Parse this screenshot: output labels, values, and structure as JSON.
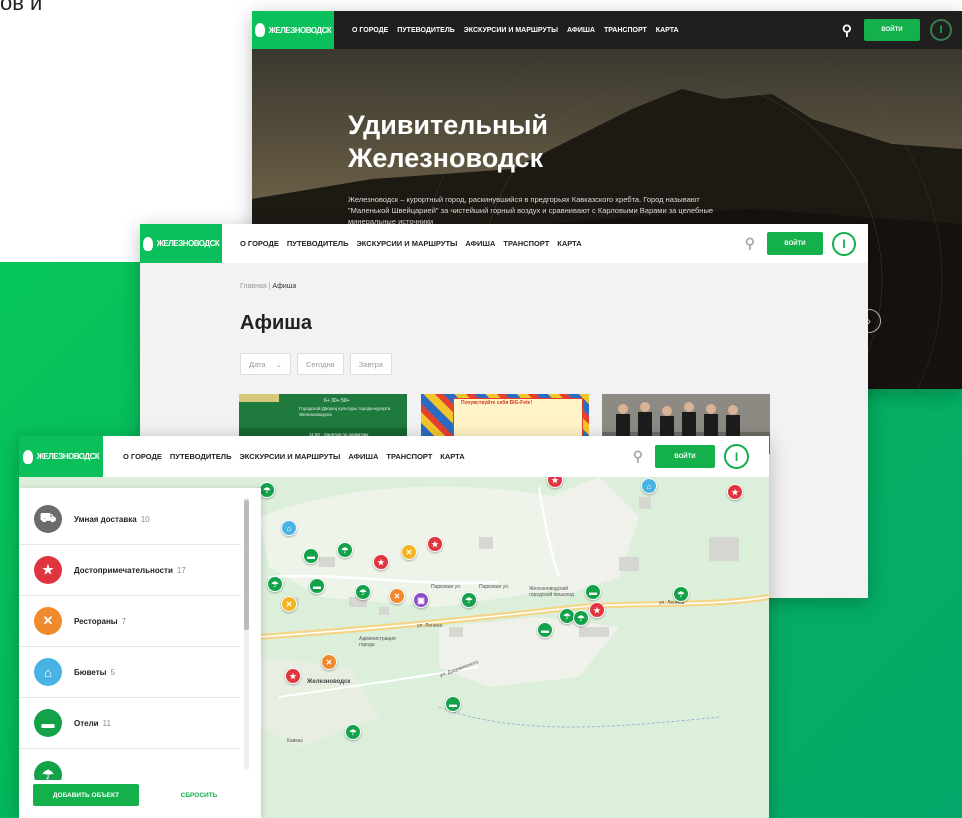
{
  "corner_text": "ов и",
  "logo_text": "ЖЕЛЕЗНОВОДСК",
  "nav_items": [
    "О ГОРОДЕ",
    "ПУТЕВОДИТЕЛЬ",
    "ЭКСКУРСИИ И МАРШРУТЫ",
    "АФИША",
    "ТРАНСПОРТ",
    "КАРТА"
  ],
  "login_label": "ВОЙТИ",
  "info_icon_glyph": "i",
  "search_icon_glyph": "⚲",
  "hero": {
    "title_line1": "Удивительный",
    "title_line2": "Железноводск",
    "text": "Железноводск – курортный город, раскинувшийся в предгорьях Кавказского хребта. Город называют \"Маленькой Швейцарией\" за чистейший горный воздух и сравнивают с Карловыми Варами за целебные минеральные источники",
    "next_arrow": "›"
  },
  "afisha": {
    "breadcrumb_home": "Главная",
    "breadcrumb_current": "Афиша",
    "title": "Афиша",
    "filters": [
      "Дата",
      "Сегодня",
      "Завтра"
    ],
    "date_chevron": "⌄",
    "card1_text": "Городской Дворец культуры города-курорта Железноводска",
    "card1_time": "11:00 - Занятия по развитию",
    "card1_age": "6+ 30+ 50+",
    "card2_text": "Почувствуйте себя BIG-Fete!"
  },
  "map": {
    "categories": [
      {
        "label": "Умная доставка",
        "count": "10",
        "color": "#6b6b6b",
        "icon": "truck-icon",
        "glyph": "⛟"
      },
      {
        "label": "Достопримечательности",
        "count": "17",
        "color": "#e0343f",
        "icon": "star-icon",
        "glyph": "★"
      },
      {
        "label": "Рестораны",
        "count": "7",
        "color": "#f08a2c",
        "icon": "fork-knife-icon",
        "glyph": "✕"
      },
      {
        "label": "Бюветы",
        "count": "5",
        "color": "#4ab3e6",
        "icon": "water-icon",
        "glyph": "⌂"
      },
      {
        "label": "Отели",
        "count": "11",
        "color": "#13a24a",
        "icon": "bed-icon",
        "glyph": "▬"
      },
      {
        "label": "",
        "count": "",
        "color": "#13a24a",
        "icon": "umbrella-icon",
        "glyph": "☂"
      }
    ],
    "add_button": "ДОБАВИТЬ ОБЪЕКТ",
    "reset_button": "СБРОСИТЬ",
    "streets": [
      "ул. Ленина",
      "ул. Ленина",
      "Парковая ул.",
      "Парковая ул.",
      "ул. Дзержинского",
      "Железноводск",
      "Администрация города",
      "Железноводский городской пешеход",
      "Кавказ"
    ],
    "city_label": "Железноводск"
  }
}
